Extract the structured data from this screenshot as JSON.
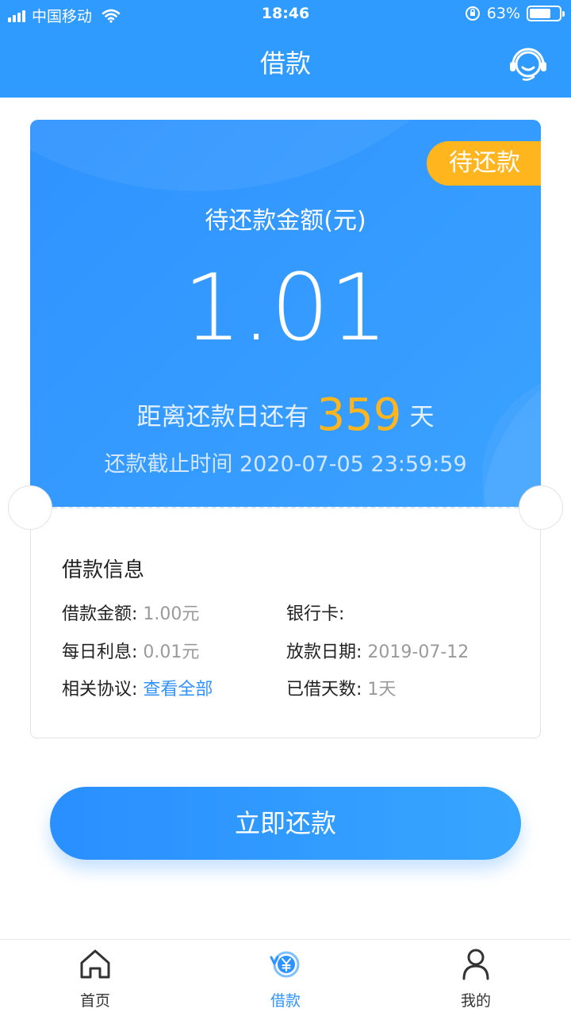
{
  "status_bar": {
    "carrier": "中国移动",
    "time": "18:46",
    "battery": "63%"
  },
  "header": {
    "title": "借款",
    "service_icon": "customer-service-icon"
  },
  "loan_card": {
    "status_tag": "待还款",
    "amount_label": "待还款金额(元)",
    "amount": "1.01",
    "days_prefix": "距离还款日还有",
    "days": "359",
    "days_suffix": "天",
    "deadline": "还款截止时间 2020-07-05 23:59:59"
  },
  "loan_info": {
    "title": "借款信息",
    "amount_label": "借款金额:",
    "amount_value": "1.00元",
    "bank_card_label": "银行卡:",
    "daily_interest_label": "每日利息:",
    "daily_interest_value": "0.01元",
    "disburse_date_label": "放款日期:",
    "disburse_date_value": "2019-07-12",
    "agreement_label": "相关协议:",
    "agreement_link": "查看全部",
    "days_borrowed_label": "已借天数:",
    "days_borrowed_value": "1天"
  },
  "repay_button": "立即还款",
  "tabbar": {
    "items": [
      {
        "label": "首页",
        "icon": "home-icon"
      },
      {
        "label": "借款",
        "icon": "yuan-loop-icon"
      },
      {
        "label": "我的",
        "icon": "person-icon"
      }
    ],
    "active": "借款"
  },
  "colors": {
    "primary": "#2f93ff",
    "accent": "#ffb51e"
  }
}
